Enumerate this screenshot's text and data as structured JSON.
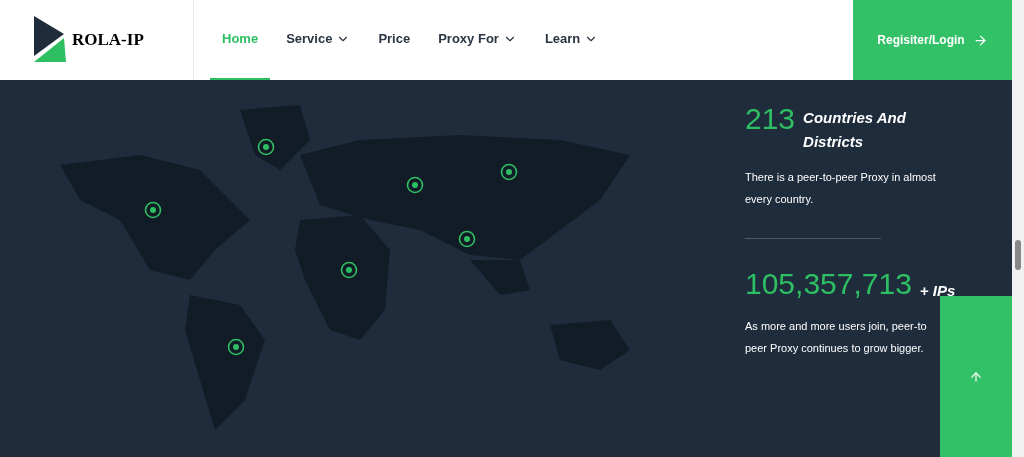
{
  "header": {
    "logo_text": "ROLA-IP",
    "nav": [
      {
        "label": "Home",
        "selected": true,
        "dropdown": false
      },
      {
        "label": "Service",
        "selected": false,
        "dropdown": true
      },
      {
        "label": "Price",
        "selected": false,
        "dropdown": false
      },
      {
        "label": "Proxy For",
        "selected": false,
        "dropdown": true
      },
      {
        "label": "Learn",
        "selected": false,
        "dropdown": true
      }
    ],
    "cta": "Regisiter/Login"
  },
  "stats": [
    {
      "number": "213",
      "label": "Countries And Districts",
      "text": "There is a peer-to-peer Proxy in almost every country."
    },
    {
      "number": "105,357,713",
      "label": "+ IPs",
      "text": "As more and more users join, peer-to peer Proxy continues to grow bigger."
    }
  ]
}
